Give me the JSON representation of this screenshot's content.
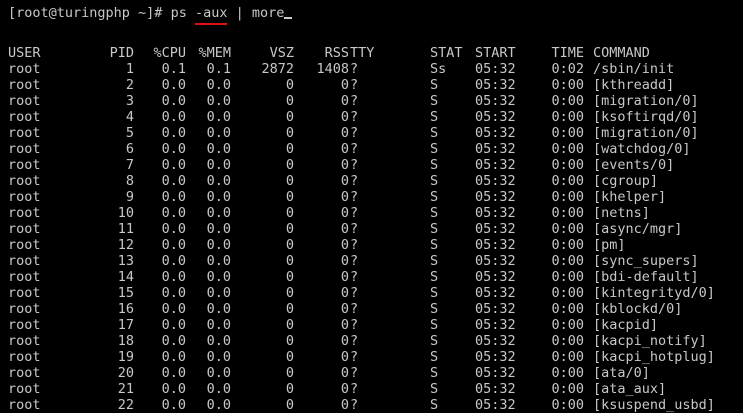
{
  "prompt": {
    "user_host": "[root@turingphp ~]# ",
    "command": "ps ",
    "flag": "-aux",
    "pipe": " | more"
  },
  "colors": {
    "background": "#000000",
    "text": "#c8c8c8",
    "underline_annotation": "#e01010"
  },
  "columns": [
    "USER",
    "PID",
    "%CPU",
    "%MEM",
    "VSZ",
    "RSS",
    "TTY",
    "STAT",
    "START",
    "TIME",
    "COMMAND"
  ],
  "rows": [
    {
      "user": "root",
      "pid": "1",
      "cpu": "0.1",
      "mem": "0.1",
      "vsz": "2872",
      "rss": "1408",
      "tty": "?",
      "stat": "Ss",
      "start": "05:32",
      "time": "0:02",
      "command": "/sbin/init"
    },
    {
      "user": "root",
      "pid": "2",
      "cpu": "0.0",
      "mem": "0.0",
      "vsz": "0",
      "rss": "0",
      "tty": "?",
      "stat": "S",
      "start": "05:32",
      "time": "0:00",
      "command": "[kthreadd]"
    },
    {
      "user": "root",
      "pid": "3",
      "cpu": "0.0",
      "mem": "0.0",
      "vsz": "0",
      "rss": "0",
      "tty": "?",
      "stat": "S",
      "start": "05:32",
      "time": "0:00",
      "command": "[migration/0]"
    },
    {
      "user": "root",
      "pid": "4",
      "cpu": "0.0",
      "mem": "0.0",
      "vsz": "0",
      "rss": "0",
      "tty": "?",
      "stat": "S",
      "start": "05:32",
      "time": "0:00",
      "command": "[ksoftirqd/0]"
    },
    {
      "user": "root",
      "pid": "5",
      "cpu": "0.0",
      "mem": "0.0",
      "vsz": "0",
      "rss": "0",
      "tty": "?",
      "stat": "S",
      "start": "05:32",
      "time": "0:00",
      "command": "[migration/0]"
    },
    {
      "user": "root",
      "pid": "6",
      "cpu": "0.0",
      "mem": "0.0",
      "vsz": "0",
      "rss": "0",
      "tty": "?",
      "stat": "S",
      "start": "05:32",
      "time": "0:00",
      "command": "[watchdog/0]"
    },
    {
      "user": "root",
      "pid": "7",
      "cpu": "0.0",
      "mem": "0.0",
      "vsz": "0",
      "rss": "0",
      "tty": "?",
      "stat": "S",
      "start": "05:32",
      "time": "0:00",
      "command": "[events/0]"
    },
    {
      "user": "root",
      "pid": "8",
      "cpu": "0.0",
      "mem": "0.0",
      "vsz": "0",
      "rss": "0",
      "tty": "?",
      "stat": "S",
      "start": "05:32",
      "time": "0:00",
      "command": "[cgroup]"
    },
    {
      "user": "root",
      "pid": "9",
      "cpu": "0.0",
      "mem": "0.0",
      "vsz": "0",
      "rss": "0",
      "tty": "?",
      "stat": "S",
      "start": "05:32",
      "time": "0:00",
      "command": "[khelper]"
    },
    {
      "user": "root",
      "pid": "10",
      "cpu": "0.0",
      "mem": "0.0",
      "vsz": "0",
      "rss": "0",
      "tty": "?",
      "stat": "S",
      "start": "05:32",
      "time": "0:00",
      "command": "[netns]"
    },
    {
      "user": "root",
      "pid": "11",
      "cpu": "0.0",
      "mem": "0.0",
      "vsz": "0",
      "rss": "0",
      "tty": "?",
      "stat": "S",
      "start": "05:32",
      "time": "0:00",
      "command": "[async/mgr]"
    },
    {
      "user": "root",
      "pid": "12",
      "cpu": "0.0",
      "mem": "0.0",
      "vsz": "0",
      "rss": "0",
      "tty": "?",
      "stat": "S",
      "start": "05:32",
      "time": "0:00",
      "command": "[pm]"
    },
    {
      "user": "root",
      "pid": "13",
      "cpu": "0.0",
      "mem": "0.0",
      "vsz": "0",
      "rss": "0",
      "tty": "?",
      "stat": "S",
      "start": "05:32",
      "time": "0:00",
      "command": "[sync_supers]"
    },
    {
      "user": "root",
      "pid": "14",
      "cpu": "0.0",
      "mem": "0.0",
      "vsz": "0",
      "rss": "0",
      "tty": "?",
      "stat": "S",
      "start": "05:32",
      "time": "0:00",
      "command": "[bdi-default]"
    },
    {
      "user": "root",
      "pid": "15",
      "cpu": "0.0",
      "mem": "0.0",
      "vsz": "0",
      "rss": "0",
      "tty": "?",
      "stat": "S",
      "start": "05:32",
      "time": "0:00",
      "command": "[kintegrityd/0]"
    },
    {
      "user": "root",
      "pid": "16",
      "cpu": "0.0",
      "mem": "0.0",
      "vsz": "0",
      "rss": "0",
      "tty": "?",
      "stat": "S",
      "start": "05:32",
      "time": "0:00",
      "command": "[kblockd/0]"
    },
    {
      "user": "root",
      "pid": "17",
      "cpu": "0.0",
      "mem": "0.0",
      "vsz": "0",
      "rss": "0",
      "tty": "?",
      "stat": "S",
      "start": "05:32",
      "time": "0:00",
      "command": "[kacpid]"
    },
    {
      "user": "root",
      "pid": "18",
      "cpu": "0.0",
      "mem": "0.0",
      "vsz": "0",
      "rss": "0",
      "tty": "?",
      "stat": "S",
      "start": "05:32",
      "time": "0:00",
      "command": "[kacpi_notify]"
    },
    {
      "user": "root",
      "pid": "19",
      "cpu": "0.0",
      "mem": "0.0",
      "vsz": "0",
      "rss": "0",
      "tty": "?",
      "stat": "S",
      "start": "05:32",
      "time": "0:00",
      "command": "[kacpi_hotplug]"
    },
    {
      "user": "root",
      "pid": "20",
      "cpu": "0.0",
      "mem": "0.0",
      "vsz": "0",
      "rss": "0",
      "tty": "?",
      "stat": "S",
      "start": "05:32",
      "time": "0:00",
      "command": "[ata/0]"
    },
    {
      "user": "root",
      "pid": "21",
      "cpu": "0.0",
      "mem": "0.0",
      "vsz": "0",
      "rss": "0",
      "tty": "?",
      "stat": "S",
      "start": "05:32",
      "time": "0:00",
      "command": "[ata_aux]"
    },
    {
      "user": "root",
      "pid": "22",
      "cpu": "0.0",
      "mem": "0.0",
      "vsz": "0",
      "rss": "0",
      "tty": "?",
      "stat": "S",
      "start": "05:32",
      "time": "0:00",
      "command": "[ksuspend_usbd]"
    }
  ]
}
